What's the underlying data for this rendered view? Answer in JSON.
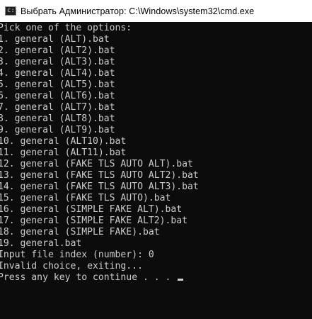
{
  "window": {
    "title": "Выбрать Администратор: C:\\Windows\\system32\\cmd.exe",
    "icon": "cmd-icon"
  },
  "console": {
    "lines": [
      "Pick one of the options:",
      "1. general (ALT).bat",
      "2. general (ALT2).bat",
      "3. general (ALT3).bat",
      "4. general (ALT4).bat",
      "5. general (ALT5).bat",
      "6. general (ALT6).bat",
      "7. general (ALT7).bat",
      "8. general (ALT8).bat",
      "9. general (ALT9).bat",
      "10. general (ALT10).bat",
      "11. general (ALT11).bat",
      "12. general (FAKE TLS AUTO ALT).bat",
      "13. general (FAKE TLS AUTO ALT2).bat",
      "14. general (FAKE TLS AUTO ALT3).bat",
      "15. general (FAKE TLS AUTO).bat",
      "16. general (SIMPLE FAKE ALT).bat",
      "17. general (SIMPLE FAKE ALT2).bat",
      "18. general (SIMPLE FAKE).bat",
      "19. general.bat",
      "Input file index (number): 0",
      "Invalid choice, exiting...",
      "Press any key to continue . . . "
    ],
    "foreground_color": "#cccccc",
    "background_color": "#0c0c0c"
  }
}
